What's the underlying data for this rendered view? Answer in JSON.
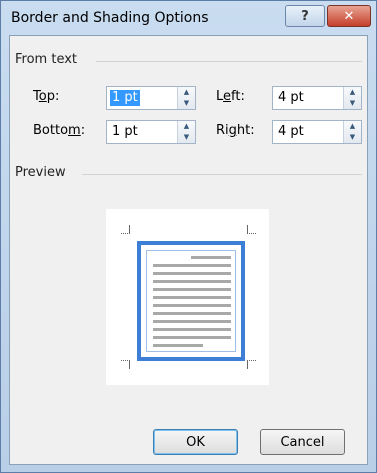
{
  "dialog": {
    "title": "Border and Shading Options",
    "help_label": "?",
    "close_label": "✕"
  },
  "from_text": {
    "label": "From text",
    "top": {
      "label_pre": "T",
      "label_u": "o",
      "label_post": "p:",
      "value": "1 pt"
    },
    "left": {
      "label_pre": "L",
      "label_u": "e",
      "label_post": "ft:",
      "value": "4 pt"
    },
    "bottom": {
      "label_pre": "Botto",
      "label_u": "m",
      "label_post": ":",
      "value": "1 pt"
    },
    "right": {
      "label_pre": "Ri",
      "label_u": "g",
      "label_post": "ht:",
      "value": "4 pt"
    }
  },
  "preview": {
    "label": "Preview"
  },
  "buttons": {
    "ok_label": "OK",
    "cancel_label": "Cancel"
  },
  "icons": {
    "spin_up": "▲",
    "spin_down": "▼"
  },
  "colors": {
    "border_preview": "#3d7fd6",
    "selection": "#3399ff"
  }
}
